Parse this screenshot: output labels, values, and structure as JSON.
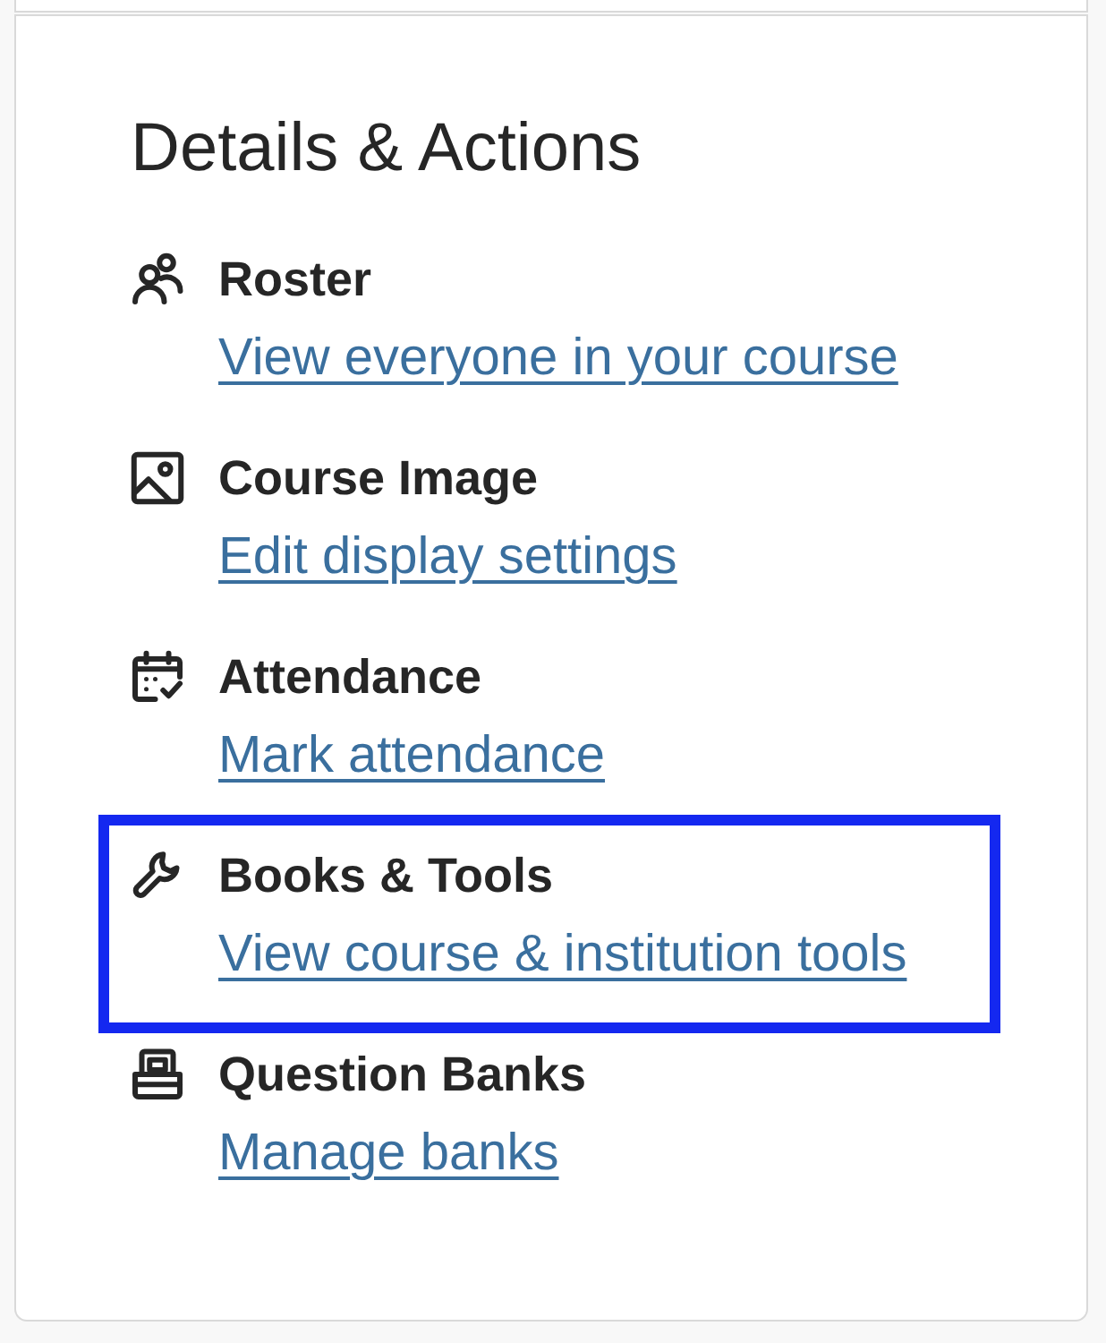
{
  "panel": {
    "title": "Details & Actions",
    "items": [
      {
        "kind": "roster",
        "title": "Roster",
        "link": "View everyone in your course",
        "focused": false
      },
      {
        "kind": "image",
        "title": "Course Image",
        "link": "Edit display settings",
        "focused": false
      },
      {
        "kind": "attendance",
        "title": "Attendance",
        "link": "Mark attendance",
        "focused": false
      },
      {
        "kind": "tools",
        "title": "Books & Tools",
        "link": "View course & institution tools",
        "focused": true
      },
      {
        "kind": "banks",
        "title": "Question Banks",
        "link": "Manage banks",
        "focused": false
      }
    ]
  }
}
